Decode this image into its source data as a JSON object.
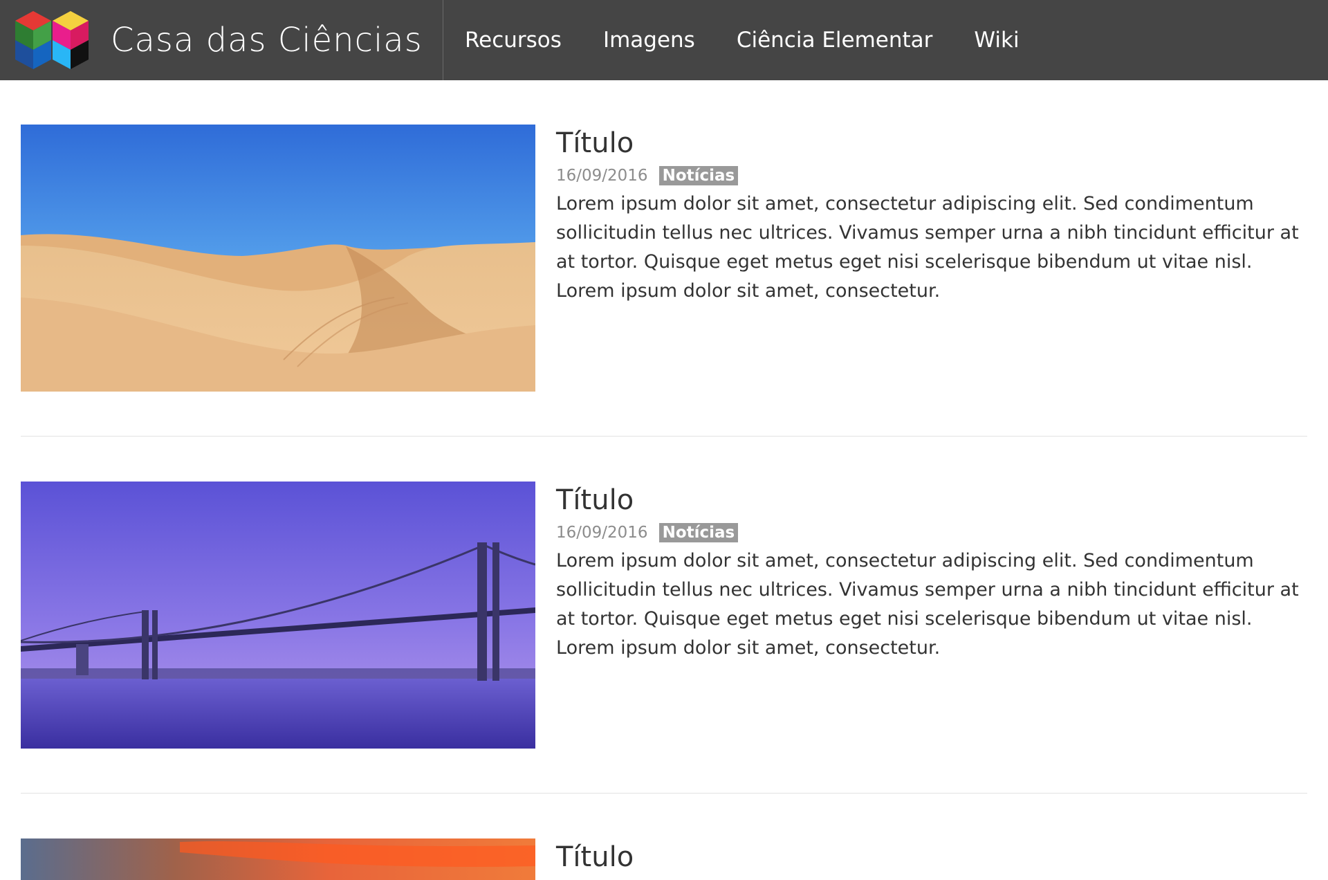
{
  "header": {
    "site_title": "Casa das Ciências",
    "nav": [
      {
        "label": "Recursos"
      },
      {
        "label": "Imagens"
      },
      {
        "label": "Ciência Elementar"
      },
      {
        "label": "Wiki"
      }
    ],
    "background_color": "#454545"
  },
  "articles": [
    {
      "title": "Título",
      "date": "16/09/2016",
      "category": "Notícias",
      "excerpt": "Lorem ipsum dolor sit amet, consectetur adipiscing elit. Sed condimentum sollicitudin tellus nec ultrices. Vivamus semper urna a nibh tincidunt efficitur at at tortor. Quisque eget metus eget nisi scelerisque bibendum ut vitae nisl. Lorem ipsum dolor sit amet, consectetur.",
      "image": "desert-dunes"
    },
    {
      "title": "Título",
      "date": "16/09/2016",
      "category": "Notícias",
      "excerpt": "Lorem ipsum dolor sit amet, consectetur adipiscing elit. Sed condimentum sollicitudin tellus nec ultrices. Vivamus semper urna a nibh tincidunt efficitur at at tortor. Quisque eget metus eget nisi scelerisque bibendum ut vitae nisl. Lorem ipsum dolor sit amet, consectetur.",
      "image": "suspension-bridge-dusk"
    },
    {
      "title": "Título",
      "image": "sunset-sky"
    }
  ],
  "colors": {
    "badge": "#999999",
    "date": "#8c8c8c",
    "divider": "#e2e2e2"
  }
}
